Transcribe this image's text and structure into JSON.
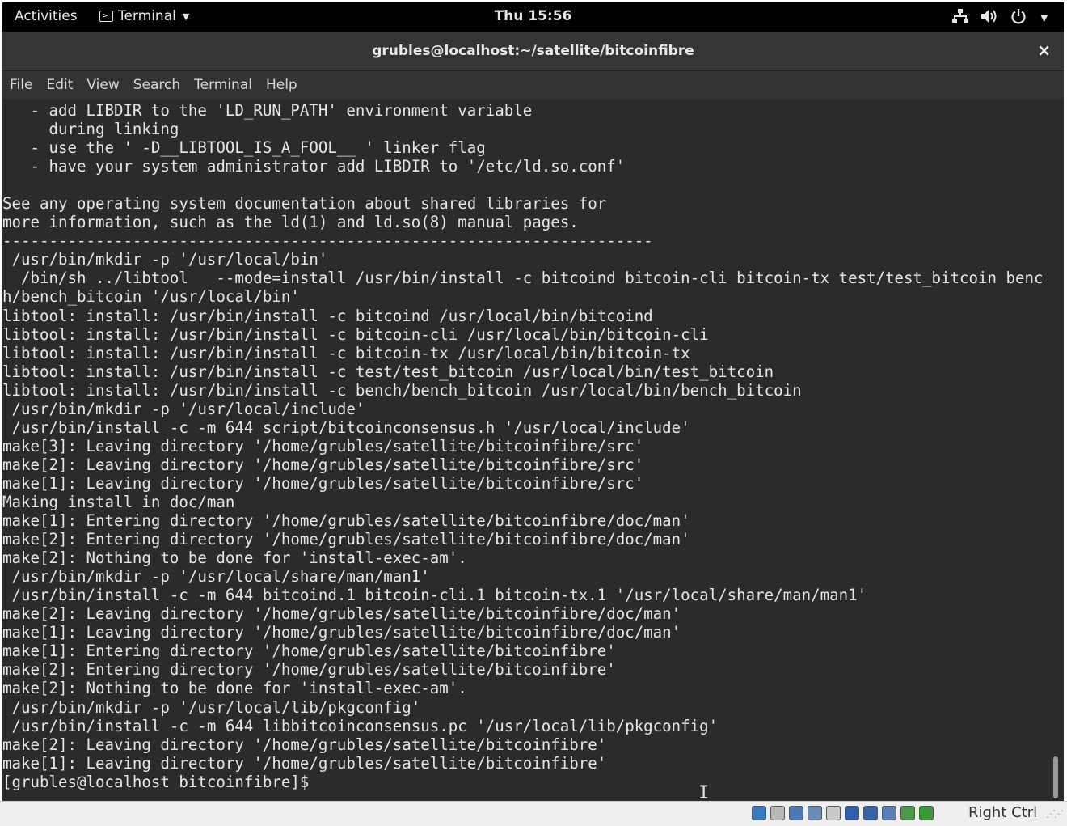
{
  "topbar": {
    "activities": "Activities",
    "app_menu": "Terminal",
    "clock": "Thu 15:56"
  },
  "window": {
    "title": "grubles@localhost:~/satellite/bitcoinfibre",
    "close": "×"
  },
  "menu": [
    "File",
    "Edit",
    "View",
    "Search",
    "Terminal",
    "Help"
  ],
  "terminal_lines": [
    "   - add LIBDIR to the 'LD_RUN_PATH' environment variable",
    "     during linking",
    "   - use the ' -D__LIBTOOL_IS_A_FOOL__ ' linker flag",
    "   - have your system administrator add LIBDIR to '/etc/ld.so.conf'",
    "",
    "See any operating system documentation about shared libraries for",
    "more information, such as the ld(1) and ld.so(8) manual pages.",
    "----------------------------------------------------------------------",
    " /usr/bin/mkdir -p '/usr/local/bin'",
    "  /bin/sh ../libtool   --mode=install /usr/bin/install -c bitcoind bitcoin-cli bitcoin-tx test/test_bitcoin benc",
    "h/bench_bitcoin '/usr/local/bin'",
    "libtool: install: /usr/bin/install -c bitcoind /usr/local/bin/bitcoind",
    "libtool: install: /usr/bin/install -c bitcoin-cli /usr/local/bin/bitcoin-cli",
    "libtool: install: /usr/bin/install -c bitcoin-tx /usr/local/bin/bitcoin-tx",
    "libtool: install: /usr/bin/install -c test/test_bitcoin /usr/local/bin/test_bitcoin",
    "libtool: install: /usr/bin/install -c bench/bench_bitcoin /usr/local/bin/bench_bitcoin",
    " /usr/bin/mkdir -p '/usr/local/include'",
    " /usr/bin/install -c -m 644 script/bitcoinconsensus.h '/usr/local/include'",
    "make[3]: Leaving directory '/home/grubles/satellite/bitcoinfibre/src'",
    "make[2]: Leaving directory '/home/grubles/satellite/bitcoinfibre/src'",
    "make[1]: Leaving directory '/home/grubles/satellite/bitcoinfibre/src'",
    "Making install in doc/man",
    "make[1]: Entering directory '/home/grubles/satellite/bitcoinfibre/doc/man'",
    "make[2]: Entering directory '/home/grubles/satellite/bitcoinfibre/doc/man'",
    "make[2]: Nothing to be done for 'install-exec-am'.",
    " /usr/bin/mkdir -p '/usr/local/share/man/man1'",
    " /usr/bin/install -c -m 644 bitcoind.1 bitcoin-cli.1 bitcoin-tx.1 '/usr/local/share/man/man1'",
    "make[2]: Leaving directory '/home/grubles/satellite/bitcoinfibre/doc/man'",
    "make[1]: Leaving directory '/home/grubles/satellite/bitcoinfibre/doc/man'",
    "make[1]: Entering directory '/home/grubles/satellite/bitcoinfibre'",
    "make[2]: Entering directory '/home/grubles/satellite/bitcoinfibre'",
    "make[2]: Nothing to be done for 'install-exec-am'.",
    " /usr/bin/mkdir -p '/usr/local/lib/pkgconfig'",
    " /usr/bin/install -c -m 644 libbitcoinconsensus.pc '/usr/local/lib/pkgconfig'",
    "make[2]: Leaving directory '/home/grubles/satellite/bitcoinfibre'",
    "make[1]: Leaving directory '/home/grubles/satellite/bitcoinfibre'",
    "[grubles@localhost bitcoinfibre]$ "
  ],
  "statusbar": {
    "host_key": "Right Ctrl",
    "icons": [
      {
        "name": "hard-disk-icon",
        "color": "#3b78c4"
      },
      {
        "name": "optical-drive-icon",
        "color": "#b8b8b8"
      },
      {
        "name": "audio-icon",
        "color": "#4a79b8"
      },
      {
        "name": "network-icon",
        "color": "#6a8bb8"
      },
      {
        "name": "usb-icon",
        "color": "#c9c9c9"
      },
      {
        "name": "shared-folders-icon",
        "color": "#2f5fa8"
      },
      {
        "name": "display-icon",
        "color": "#3463a8"
      },
      {
        "name": "video-capture-icon",
        "color": "#5a7fb8"
      },
      {
        "name": "cpu-icon",
        "color": "#4a9a4a"
      },
      {
        "name": "mouse-integration-icon",
        "color": "#3a9a3a"
      }
    ]
  },
  "colors": {
    "terminal_bg": "#2b2b2b",
    "terminal_fg": "#e6e6e6",
    "topbar_bg": "#000000",
    "titlebar_bg": "#353535"
  }
}
